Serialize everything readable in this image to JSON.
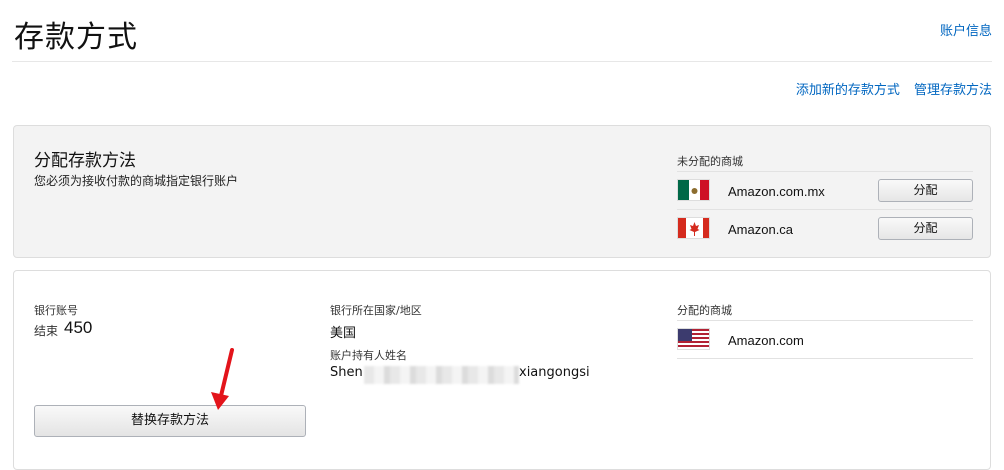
{
  "header": {
    "title": "存款方式",
    "account_info_link": "账户信息"
  },
  "top_links": {
    "add_new": "添加新的存款方式",
    "manage": "管理存款方法"
  },
  "assign_section": {
    "title": "分配存款方法",
    "subtitle": "您必须为接收付款的商城指定银行账户",
    "unassigned_header": "未分配的商城",
    "marketplaces": [
      {
        "name": "Amazon.com.mx",
        "flag": "mexico-flag-icon",
        "button": "分配"
      },
      {
        "name": "Amazon.ca",
        "flag": "canada-flag-icon",
        "button": "分配"
      }
    ]
  },
  "bank_section": {
    "account_label": "银行账号",
    "ending_prefix": "结束",
    "ending_digits": "450",
    "country_label": "银行所在国家/地区",
    "country_value": "美国",
    "holder_label": "账户持有人姓名",
    "holder_start": "Shen",
    "holder_end": "xiangongsi",
    "assigned_header": "分配的商城",
    "assigned_marketplaces": [
      {
        "name": "Amazon.com",
        "flag": "usa-flag-icon"
      }
    ],
    "replace_button": "替换存款方法"
  },
  "colors": {
    "link": "#0066c0",
    "panel_bg": "#f3f3f3",
    "arrow": "#e3141b"
  }
}
